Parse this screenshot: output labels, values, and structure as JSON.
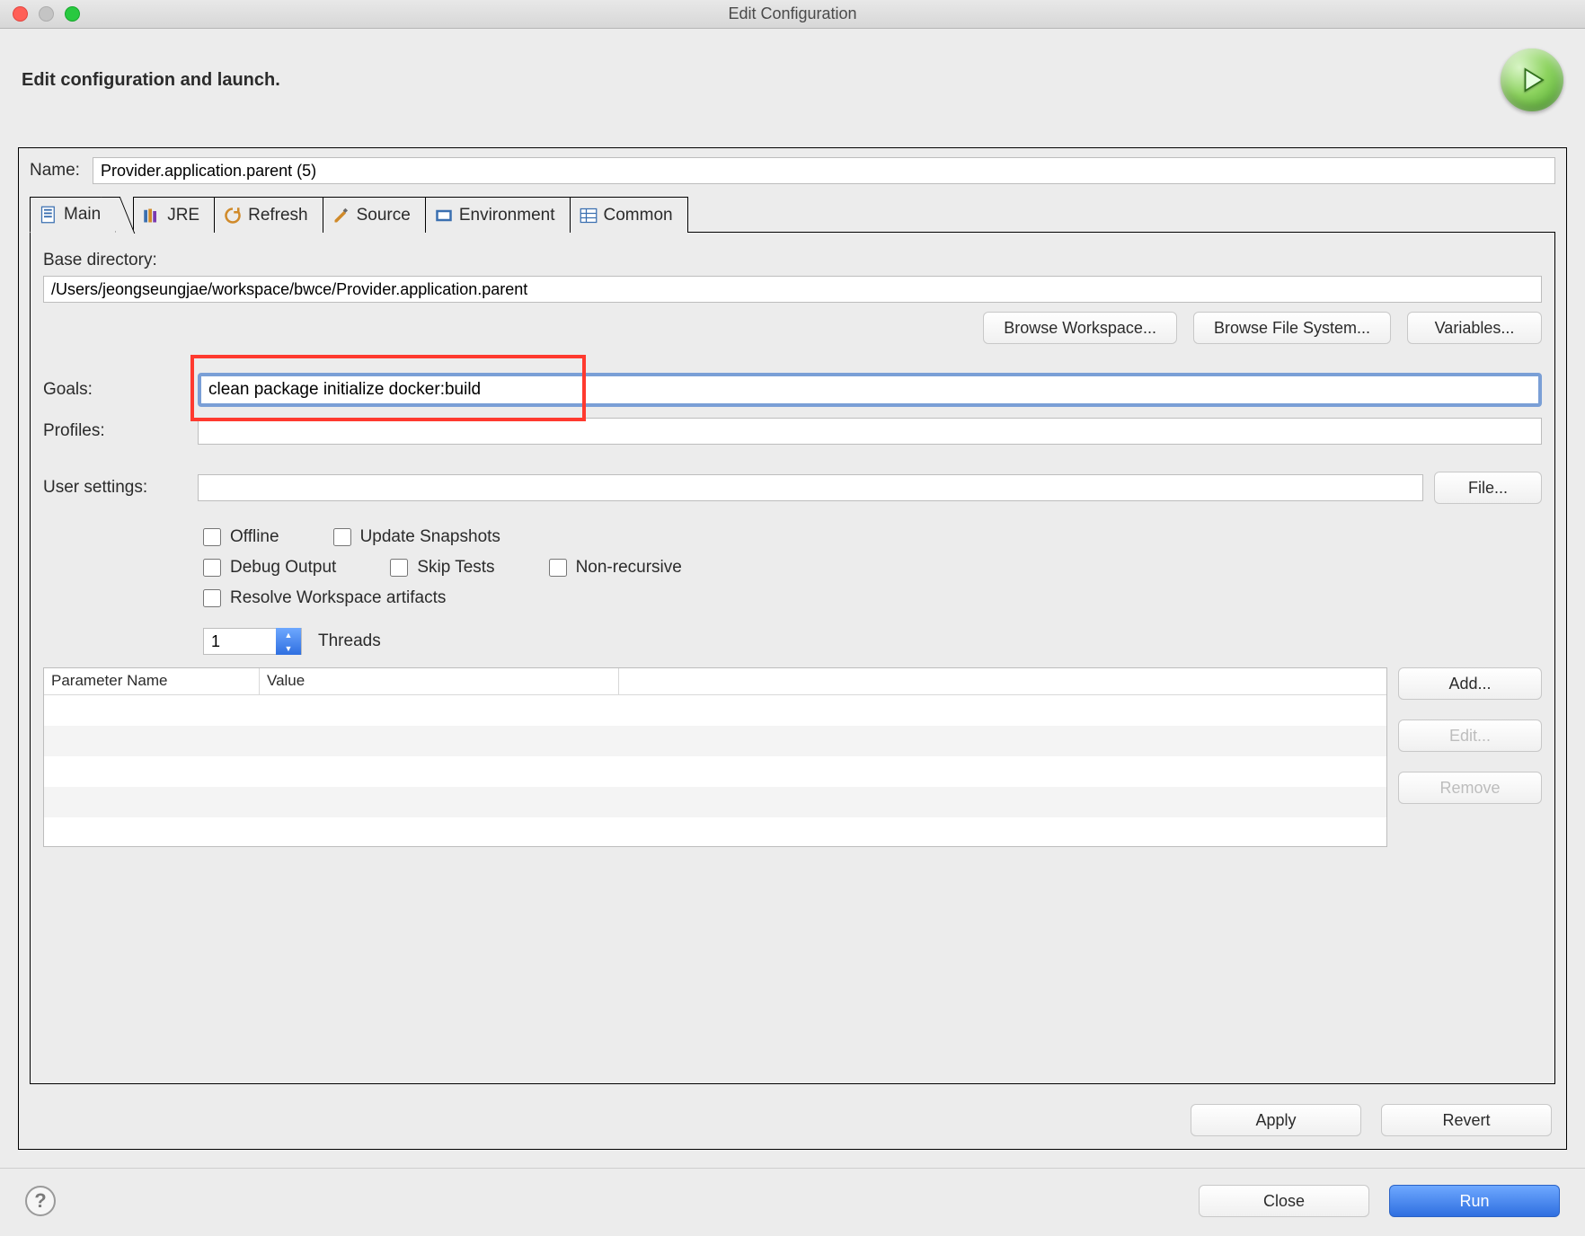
{
  "window": {
    "title": "Edit Configuration"
  },
  "header": {
    "title": "Edit configuration and launch."
  },
  "form": {
    "name_label": "Name:",
    "name_value": "Provider.application.parent (5)"
  },
  "tabs": [
    {
      "id": "main",
      "label": "Main",
      "icon": "page-icon"
    },
    {
      "id": "jre",
      "label": "JRE",
      "icon": "books-icon"
    },
    {
      "id": "refresh",
      "label": "Refresh",
      "icon": "refresh-icon"
    },
    {
      "id": "source",
      "label": "Source",
      "icon": "pencil-icon"
    },
    {
      "id": "environment",
      "label": "Environment",
      "icon": "env-icon"
    },
    {
      "id": "common",
      "label": "Common",
      "icon": "table-icon"
    }
  ],
  "main": {
    "base_dir_label": "Base directory:",
    "base_dir_value": "/Users/jeongseungjae/workspace/bwce/Provider.application.parent",
    "browse_workspace": "Browse Workspace...",
    "browse_filesystem": "Browse File System...",
    "variables": "Variables...",
    "goals_label": "Goals:",
    "goals_value": "clean package initialize docker:build",
    "profiles_label": "Profiles:",
    "profiles_value": "",
    "user_settings_label": "User settings:",
    "user_settings_value": "",
    "file_btn": "File...",
    "checks": {
      "offline": "Offline",
      "update_snapshots": "Update Snapshots",
      "debug_output": "Debug Output",
      "skip_tests": "Skip Tests",
      "non_recursive": "Non-recursive",
      "resolve_workspace": "Resolve Workspace artifacts"
    },
    "threads_value": "1",
    "threads_label": "Threads",
    "param_table": {
      "col_name": "Parameter Name",
      "col_value": "Value"
    },
    "param_btns": {
      "add": "Add...",
      "edit": "Edit...",
      "remove": "Remove"
    }
  },
  "actions": {
    "apply": "Apply",
    "revert": "Revert",
    "close": "Close",
    "run": "Run"
  }
}
